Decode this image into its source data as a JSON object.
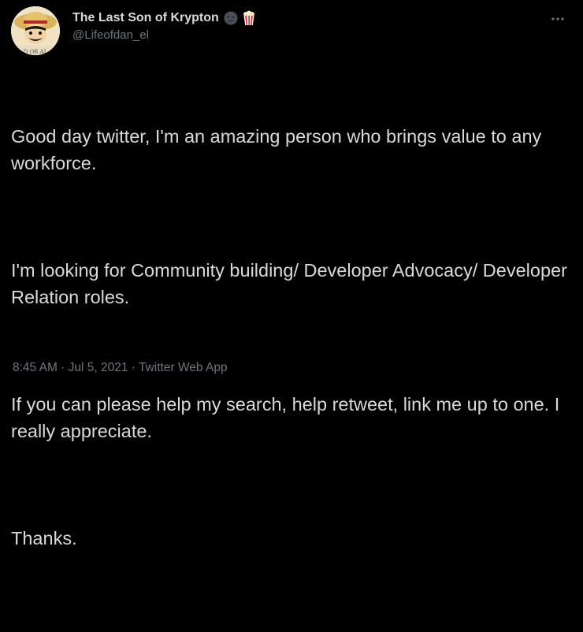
{
  "user": {
    "display_name": "The Last Son of Krypton",
    "handle": "@Lifeofdan_el",
    "avatar_text": "D OR AL",
    "name_emojis": [
      "new-moon-face-icon",
      "popcorn-icon"
    ]
  },
  "tweet": {
    "paragraphs": [
      "Good day twitter, I'm an amazing person who brings value to any workforce.",
      "I'm looking for Community building/ Developer Advocacy/ Developer Relation roles.",
      "If you can please help my search, help retweet, link me up to one. I really appreciate.",
      "Thanks."
    ],
    "time": "8:45 AM",
    "separator": " · ",
    "date": "Jul 5, 2021",
    "source": "Twitter Web App"
  },
  "colors": {
    "background": "#000000",
    "text": "#d9d9d9",
    "secondary": "#6e767d"
  },
  "icons": {
    "more": "more-horizontal-icon"
  }
}
